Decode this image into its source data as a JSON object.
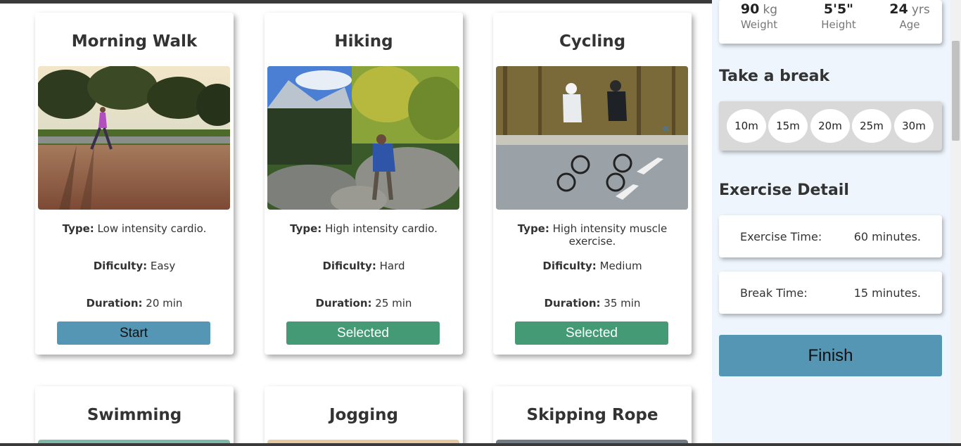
{
  "cards": [
    {
      "title": "Morning Walk",
      "type_label": "Type:",
      "type": "Low intensity cardio.",
      "difficulty_label": "Dificulty:",
      "difficulty": "Easy",
      "duration_label": "Duration:",
      "duration": "20 min",
      "button": "Start",
      "image": "morning-walk-photo"
    },
    {
      "title": "Hiking",
      "type_label": "Type:",
      "type": "High intensity cardio.",
      "difficulty_label": "Dificulty:",
      "difficulty": "Hard",
      "duration_label": "Duration:",
      "duration": "25 min",
      "button": "Selected",
      "image": "hiking-photo"
    },
    {
      "title": "Cycling",
      "type_label": "Type:",
      "type": "High intensity muscle exercise.",
      "difficulty_label": "Dificulty:",
      "difficulty": "Medium",
      "duration_label": "Duration:",
      "duration": "35 min",
      "button": "Selected",
      "image": "cycling-photo"
    },
    {
      "title": "Swimming"
    },
    {
      "title": "Jogging"
    },
    {
      "title": "Skipping Rope"
    }
  ],
  "profile": {
    "weight": {
      "value": "90",
      "unit": "kg",
      "label": "Weight"
    },
    "height": {
      "value": "5'5\"",
      "label": "Height"
    },
    "age": {
      "value": "24",
      "unit": "yrs",
      "label": "Age"
    }
  },
  "break_section": {
    "title": "Take a break",
    "options": [
      "10m",
      "15m",
      "20m",
      "25m",
      "30m"
    ]
  },
  "detail_section": {
    "title": "Exercise Detail",
    "exercise_time_label": "Exercise Time:",
    "exercise_time_value": "60 minutes.",
    "break_time_label": "Break Time:",
    "break_time_value": "15 minutes."
  },
  "finish_button": "Finish",
  "colors": {
    "start_button": "#5596b5",
    "selected_button": "#449a75",
    "sidebar_bg": "#eef5fc"
  }
}
